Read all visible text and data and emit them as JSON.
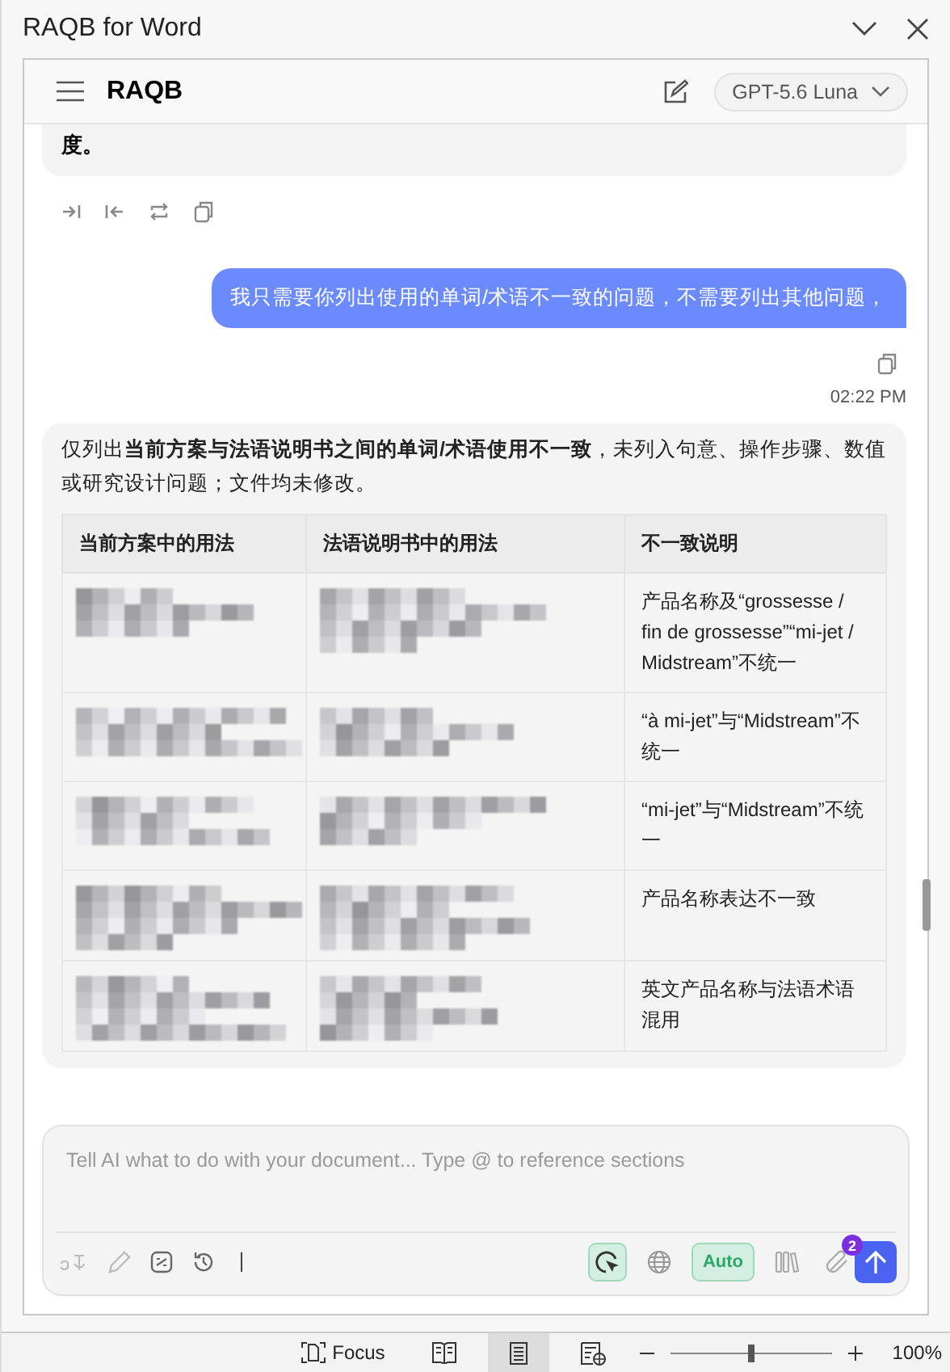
{
  "window": {
    "title": "RAQB for Word"
  },
  "header": {
    "title": "RAQB",
    "model": "GPT-5.6 Luna"
  },
  "previous_reply": {
    "text": "度。"
  },
  "user_message": {
    "text": "我只需要你列出使用的单词/术语不一致的问题，不需要列出其他问题，",
    "time": "02:22 PM"
  },
  "reply": {
    "intro": "仅列出**当前方案与法语说明书之间的单词/术语使用不一致**，未列入句意、操作步骤、数值或研究设计问题；文件均未修改。",
    "table": {
      "columns": [
        "当前方案中的用法",
        "法语说明书中的用法",
        "不一致说明"
      ],
      "rows": [
        {
          "column_3": "产品名称及“grossesse / fin de grossesse”“mi-jet / Midstream”不统一"
        },
        {
          "column_3": "“à mi-jet”与“Midstream”不统一"
        },
        {
          "column_3": "“mi-jet”与“Midstream”不统一"
        },
        {
          "column_3": "产品名称表达不一致"
        },
        {
          "column_3": "英文产品名称与法语术语混用"
        }
      ]
    }
  },
  "composer": {
    "placeholder": "Tell AI what to do with your document... Type @ to reference sections",
    "tools": [
      {
        "kind": "cursor",
        "selected": true
      },
      {
        "kind": "globe",
        "selected": false
      },
      {
        "kind": "auto",
        "label": "Auto",
        "selected": true
      },
      {
        "kind": "library",
        "selected": false
      },
      {
        "kind": "attach",
        "badge": "2"
      }
    ]
  },
  "status_bar": {
    "focus": "Focus",
    "views": [
      {
        "kind": "read",
        "selected": false
      },
      {
        "kind": "print",
        "selected": true
      },
      {
        "kind": "web",
        "selected": false
      }
    ],
    "zoom": {
      "level": 0.5,
      "reading": "100%"
    }
  }
}
